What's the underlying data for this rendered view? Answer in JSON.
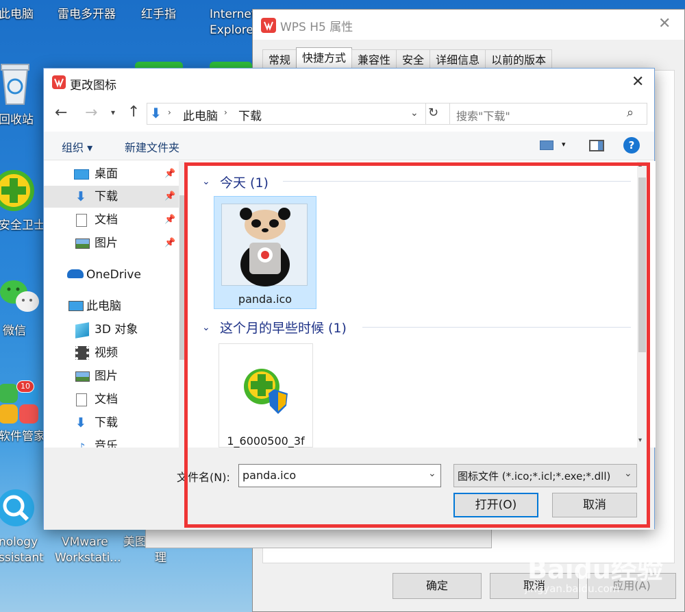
{
  "desktop": {
    "icons": [
      {
        "label": "此电脑"
      },
      {
        "label": "雷电多开器"
      },
      {
        "label": "红手指"
      },
      {
        "label": "Internet"
      },
      {
        "label": "Explorer"
      },
      {
        "label": "回收站"
      },
      {
        "label": "安全卫士"
      },
      {
        "label": "微信"
      },
      {
        "label": "软件管家"
      },
      {
        "label": "10"
      },
      {
        "label": "nology"
      },
      {
        "label": "ssistant"
      },
      {
        "label": "VMware"
      },
      {
        "label": "Workstati..."
      },
      {
        "label": "美图"
      },
      {
        "label": "理"
      }
    ]
  },
  "properties_window": {
    "title": "WPS H5 属性",
    "tabs": [
      "常规",
      "快捷方式",
      "兼容性",
      "安全",
      "详细信息",
      "以前的版本"
    ],
    "active_tab": 1,
    "ok_label": "确定",
    "cancel_label": "取消",
    "apply_label": "应用(A)"
  },
  "dialog": {
    "title": "更改图标",
    "breadcrumb": [
      "此电脑",
      "下载"
    ],
    "search_placeholder": "搜索\"下载\"",
    "organize_label": "组织 ▾",
    "new_folder_label": "新建文件夹",
    "nav_items": [
      {
        "label": "桌面",
        "icon": "desktop-icon",
        "pinned": true
      },
      {
        "label": "下载",
        "icon": "download-icon",
        "pinned": true,
        "selected": true
      },
      {
        "label": "文档",
        "icon": "document-icon",
        "pinned": true
      },
      {
        "label": "图片",
        "icon": "picture-icon",
        "pinned": true
      },
      {
        "label": "OneDrive",
        "icon": "onedrive-icon"
      },
      {
        "label": "此电脑",
        "icon": "computer-icon"
      },
      {
        "label": "3D 对象",
        "icon": "3d-objects-icon"
      },
      {
        "label": "视频",
        "icon": "video-icon"
      },
      {
        "label": "图片",
        "icon": "picture-icon"
      },
      {
        "label": "文档",
        "icon": "document-icon"
      },
      {
        "label": "下载",
        "icon": "download-icon"
      },
      {
        "label": "音乐",
        "icon": "music-icon"
      }
    ],
    "groups": [
      {
        "header": "今天 (1)",
        "files": [
          {
            "name": "panda.ico",
            "icon": "panda-icon",
            "selected": true
          }
        ]
      },
      {
        "header": "这个月的早些时候 (1)",
        "files": [
          {
            "name": "1_6000500_3f",
            "icon": "security-guard-icon",
            "selected": false
          }
        ]
      }
    ],
    "filename_label": "文件名(N):",
    "filename_value": "panda.ico",
    "filetype_value": "图标文件 (*.ico;*.icl;*.exe;*.dll)",
    "open_label": "打开(O)",
    "cancel_label": "取消"
  },
  "watermark": {
    "brand": "Baidu经验",
    "url": "jingyan.baidu.com"
  },
  "colors": {
    "highlight_box": "#ee3535",
    "accent": "#0078d7",
    "selected_tile": "#cce8ff"
  }
}
